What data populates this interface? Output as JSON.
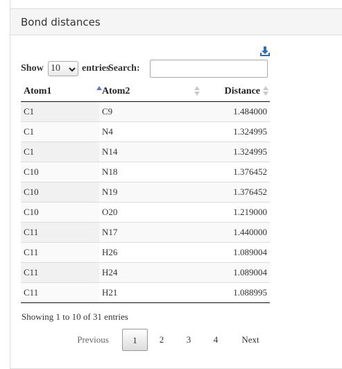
{
  "panel": {
    "title": "Bond distances"
  },
  "icons": {
    "download": "download-icon"
  },
  "controls": {
    "show_label": "Show",
    "length_value": "10",
    "entries_label": "entries",
    "search_label": "Search:",
    "search_value": ""
  },
  "table": {
    "columns": [
      {
        "label": "Atom1",
        "sort": "ascending"
      },
      {
        "label": "Atom2",
        "sort": "none"
      },
      {
        "label": "Distance",
        "sort": "none"
      }
    ],
    "rows": [
      [
        "C1",
        "C9",
        "1.484000"
      ],
      [
        "C1",
        "N4",
        "1.324995"
      ],
      [
        "C1",
        "N14",
        "1.324995"
      ],
      [
        "C10",
        "N18",
        "1.376452"
      ],
      [
        "C10",
        "N19",
        "1.376452"
      ],
      [
        "C10",
        "O20",
        "1.219000"
      ],
      [
        "C11",
        "N17",
        "1.440000"
      ],
      [
        "C11",
        "H26",
        "1.089004"
      ],
      [
        "C11",
        "H24",
        "1.089004"
      ],
      [
        "C11",
        "H21",
        "1.088995"
      ]
    ]
  },
  "info": "Showing 1 to 10 of 31 entries",
  "pagination": {
    "previous": "Previous",
    "pages": [
      "1",
      "2",
      "3",
      "4"
    ],
    "current": "1",
    "next": "Next"
  },
  "colors": {
    "sort_active": "#6b78c7",
    "sort_inactive": "#c9c9c9",
    "download_icon": "#2f6fad"
  }
}
